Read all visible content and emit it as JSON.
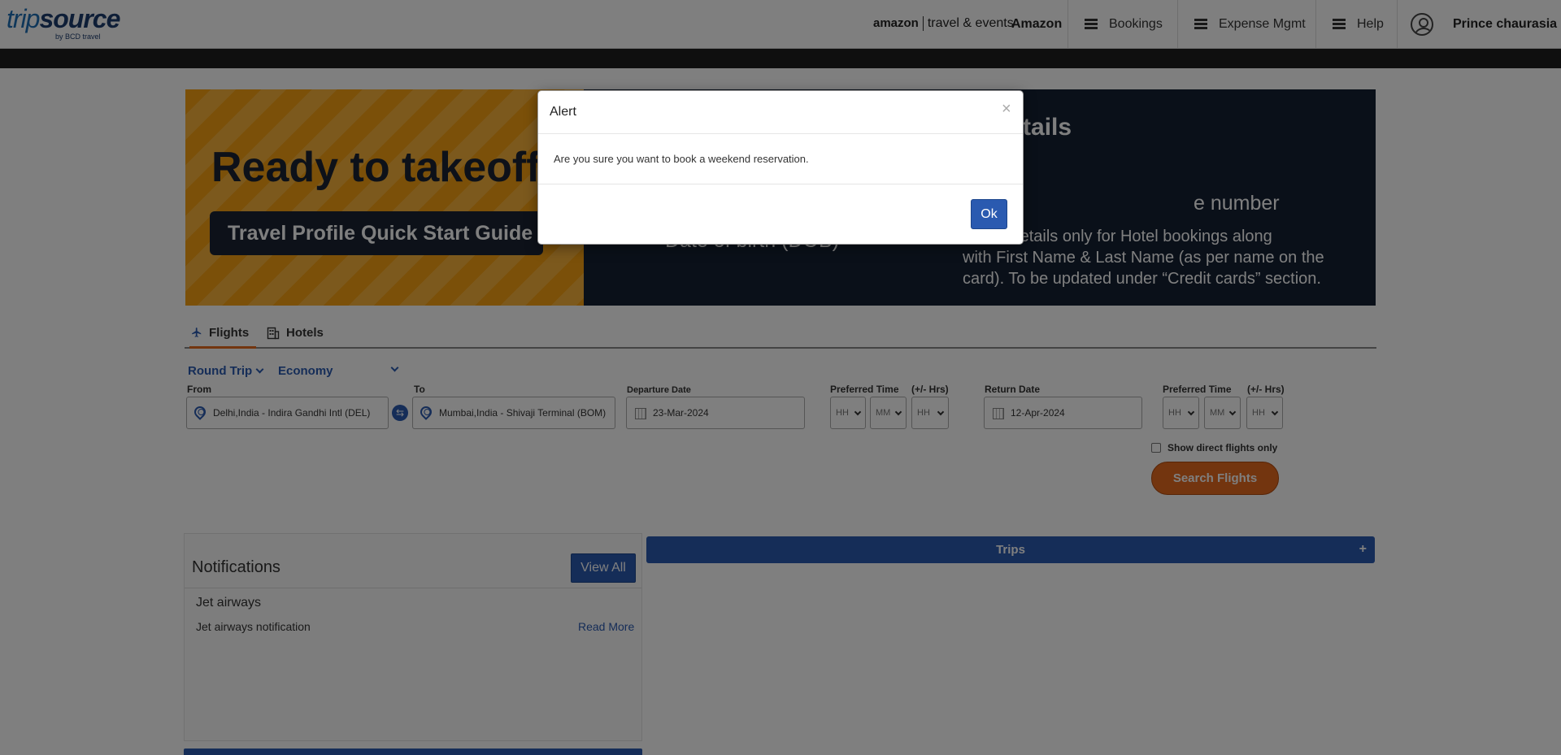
{
  "header": {
    "logo_trip": "trip",
    "logo_source": "source",
    "logo_sub": "by BCD travel",
    "brand_amazon": "amazon",
    "brand_suffix": "travel & events",
    "company": "Amazon",
    "nav": [
      {
        "label": "Bookings",
        "icon": "menu-icon"
      },
      {
        "label": "Expense Mgmt",
        "icon": "menu-icon"
      },
      {
        "label": "Help",
        "icon": "menu-icon"
      }
    ],
    "user_name": "Prince chaurasia"
  },
  "banner": {
    "title": "Ready to takeoff?",
    "button": "Travel Profile Quick Start Guide",
    "right_heading": "elow details",
    "right_line1": "e number",
    "right_line2": "Date of birth (DOB)",
    "right_para": [
      "ard details only for Hotel bookings along",
      "with First Name & Last Name (as per name on the",
      "card). To be updated under “Credit cards” section."
    ]
  },
  "tabs": [
    {
      "label": "Flights",
      "icon": "airplane-icon",
      "active": true
    },
    {
      "label": "Hotels",
      "icon": "building-icon",
      "active": false
    }
  ],
  "search": {
    "trip_type": "Round Trip",
    "cabin_class": "Economy",
    "from_label": "From",
    "from_value": "Delhi,India - Indira Gandhi Intl (DEL)",
    "to_label": "To",
    "to_value": "Mumbai,India - Shivaji Terminal (BOM)",
    "departure_label": "Departure Date",
    "departure_value": "23-Mar-2024",
    "pref_time_label": "Preferred Time",
    "plus_minus_label": "(+/- Hrs)",
    "return_label": "Return Date",
    "return_value": "12-Apr-2024",
    "hh": "HH",
    "mm": "MM",
    "direct_only": "Show direct flights only",
    "search_button": "Search Flights"
  },
  "notifications": {
    "title": "Notifications",
    "view_all": "View All",
    "item_title": "Jet airways",
    "item_text": "Jet airways notification",
    "read_more": "Read More"
  },
  "trips": {
    "label": "Trips",
    "toggle": "+"
  },
  "modal": {
    "title": "Alert",
    "close": "×",
    "message": "Are you sure you want to book a weekend reservation.",
    "ok": "Ok"
  },
  "colors": {
    "accent_blue": "#2a5ab0",
    "accent_orange": "#e66a1f",
    "banner_orange": "#f6a113",
    "banner_navy": "#142033"
  }
}
